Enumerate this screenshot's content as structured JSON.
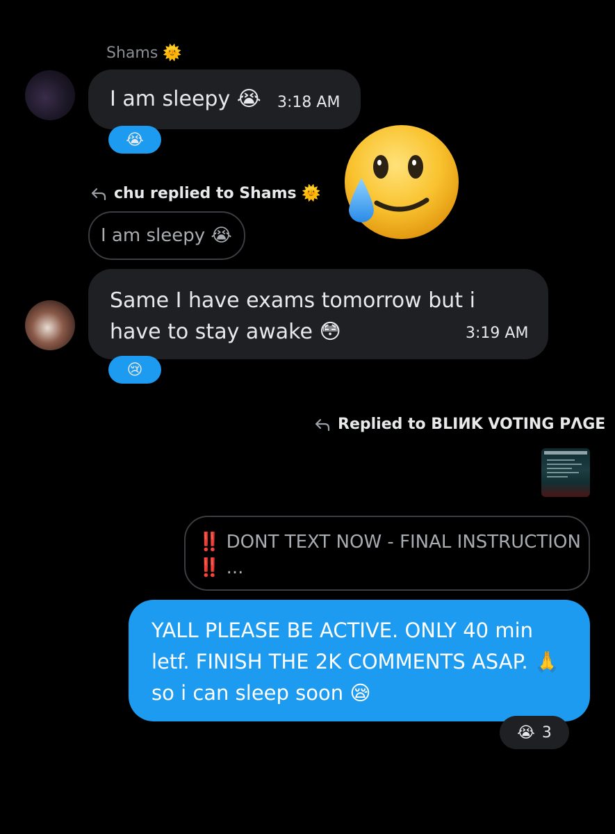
{
  "conversation": {
    "msg1": {
      "sender": "Shams 🌞",
      "text": "I am sleepy 😭",
      "time": "3:18 AM",
      "reaction": "😭"
    },
    "reply_banner_1": "chu replied to Shams 🌞",
    "quoted_1": "I am sleepy 😭",
    "msg2": {
      "text": "Same I have exams tomorrow but i have to stay awake 😳",
      "time": "3:19 AM",
      "reaction": "😢"
    },
    "reply_banner_2": "Replied to BLIИK VOTING PΛGE",
    "quoted_2": "‼️ DONT TEXT NOW - FINAL INSTRUCTION ‼️ ...",
    "msg3": {
      "text": "YALL PLEASE BE ACTIVE. ONLY 40 min letf.  FINISH THE 2K COMMENTS ASAP. 🙏  so i can sleep  soon 😪",
      "reaction_emoji": "😭",
      "reaction_count": "3"
    }
  },
  "colors": {
    "background": "#000000",
    "incoming_bubble": "#1f2023",
    "outgoing_bubble": "#1d9bf0",
    "reaction_pill": "#1d9bf0"
  },
  "icons": [
    "reply-arrow-icon",
    "smiling-face-with-tear-icon"
  ]
}
